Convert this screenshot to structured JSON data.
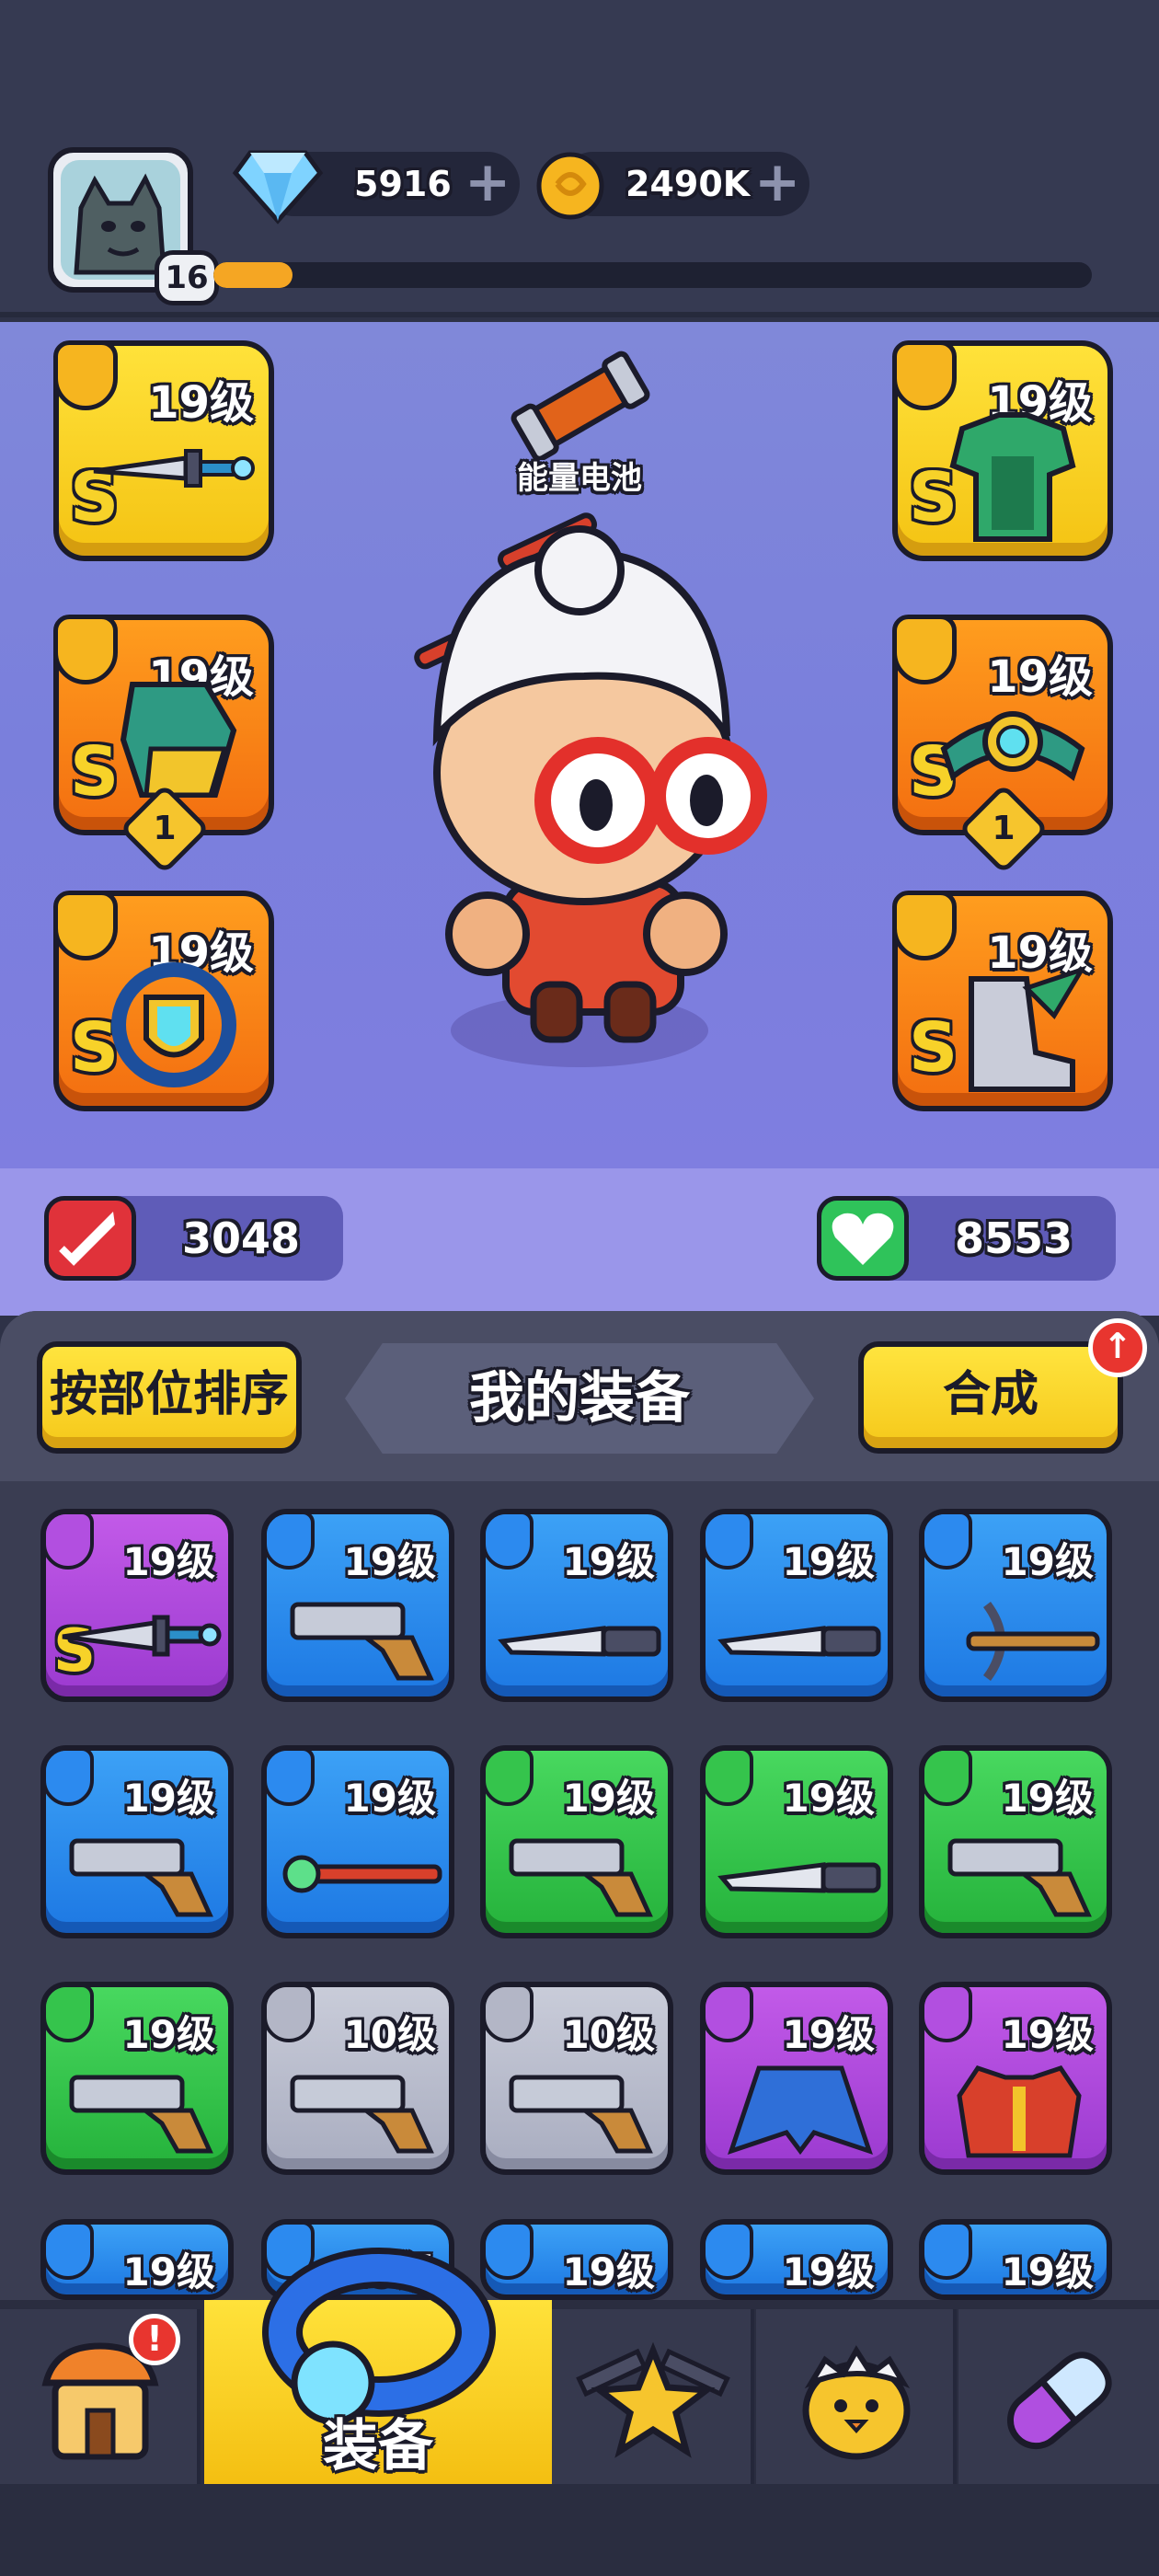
{
  "header": {
    "player_level": "16",
    "xp_progress": 0.09,
    "gems": "5916",
    "coins": "2490K"
  },
  "character": {
    "battery_label": "能量电池",
    "attack": "3048",
    "health": "8553",
    "slots": [
      {
        "level": "19级",
        "grade": "S",
        "rarity": "gold",
        "slot_icon": "gun-icon"
      },
      {
        "level": "19级",
        "grade": "S",
        "rarity": "gold",
        "slot_icon": "armor-icon"
      },
      {
        "level": "19级",
        "grade": "S",
        "rarity": "orange",
        "slot_icon": "glove-icon",
        "count": "1"
      },
      {
        "level": "19级",
        "grade": "S",
        "rarity": "orange",
        "slot_icon": "belt-icon",
        "count": "1"
      },
      {
        "level": "19级",
        "grade": "S",
        "rarity": "orange",
        "slot_icon": "ring-icon"
      },
      {
        "level": "19级",
        "grade": "S",
        "rarity": "orange",
        "slot_icon": "boot-icon"
      }
    ]
  },
  "panel": {
    "sort_label": "按部位排序",
    "title": "我的装备",
    "merge_label": "合成",
    "merge_badge": "↑"
  },
  "inventory": [
    {
      "level": "19级",
      "rarity": "purple",
      "grade": "S",
      "type": "dagger"
    },
    {
      "level": "19级",
      "rarity": "blue",
      "type": "pistol"
    },
    {
      "level": "19级",
      "rarity": "blue",
      "type": "knife"
    },
    {
      "level": "19级",
      "rarity": "blue",
      "type": "knife"
    },
    {
      "level": "19级",
      "rarity": "blue",
      "type": "crossbow"
    },
    {
      "level": "19级",
      "rarity": "blue",
      "type": "revolver"
    },
    {
      "level": "19级",
      "rarity": "blue",
      "type": "wand"
    },
    {
      "level": "19级",
      "rarity": "green",
      "type": "pistol"
    },
    {
      "level": "19级",
      "rarity": "green",
      "type": "knife"
    },
    {
      "level": "19级",
      "rarity": "green",
      "type": "revolver"
    },
    {
      "level": "19级",
      "rarity": "green",
      "type": "revolver"
    },
    {
      "level": "10级",
      "rarity": "gray",
      "type": "pistol"
    },
    {
      "level": "10级",
      "rarity": "gray",
      "type": "pistol"
    },
    {
      "level": "19级",
      "rarity": "purple",
      "type": "cape"
    },
    {
      "level": "19级",
      "rarity": "purple",
      "type": "vest"
    },
    {
      "level": "19级",
      "rarity": "blue",
      "type": "armor"
    },
    {
      "level": "19级",
      "rarity": "blue",
      "type": "armor"
    },
    {
      "level": "19级",
      "rarity": "blue",
      "type": "armor"
    },
    {
      "level": "19级",
      "rarity": "blue",
      "type": "armor"
    },
    {
      "level": "19级",
      "rarity": "blue",
      "type": "armor"
    }
  ],
  "nav": {
    "equip_label": "装备",
    "shop_badge": "!"
  },
  "colors": {
    "gold": "#f4c313",
    "orange": "#f36e10",
    "purple": "#9b3ad0",
    "blue": "#1d78e3",
    "green": "#25b23b",
    "gray": "#a9adc0",
    "xp": "#f5a623"
  }
}
